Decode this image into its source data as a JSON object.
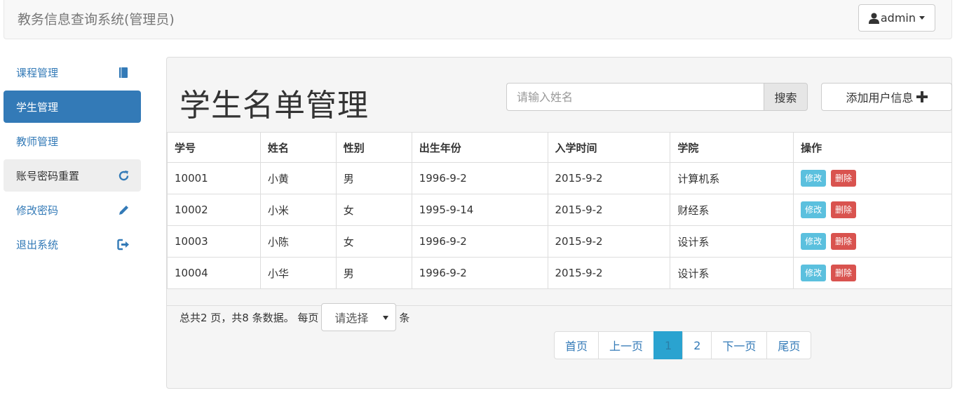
{
  "navbar": {
    "brand": "教务信息查询系统(管理员)",
    "user_label": "admin"
  },
  "sidebar": {
    "items": [
      {
        "label": "课程管理",
        "icon": "book-icon",
        "state": "normal"
      },
      {
        "label": "学生管理",
        "icon": "",
        "state": "active"
      },
      {
        "label": "教师管理",
        "icon": "",
        "state": "normal"
      },
      {
        "label": "账号密码重置",
        "icon": "refresh-icon",
        "state": "hover"
      },
      {
        "label": "修改密码",
        "icon": "pencil-icon",
        "state": "normal"
      },
      {
        "label": "退出系统",
        "icon": "logout-icon",
        "state": "normal"
      }
    ]
  },
  "main": {
    "title": "学生名单管理",
    "search": {
      "placeholder": "请输入姓名",
      "button_label": "搜索"
    },
    "add_button_label": "添加用户信息",
    "table": {
      "headers": [
        "学号",
        "姓名",
        "性别",
        "出生年份",
        "入学时间",
        "学院",
        "操作"
      ],
      "rows": [
        [
          "10001",
          "小黄",
          "男",
          "1996-9-2",
          "2015-9-2",
          "计算机系"
        ],
        [
          "10002",
          "小米",
          "女",
          "1995-9-14",
          "2015-9-2",
          "财经系"
        ],
        [
          "10003",
          "小陈",
          "女",
          "1996-9-2",
          "2015-9-2",
          "设计系"
        ],
        [
          "10004",
          "小华",
          "男",
          "1996-9-2",
          "2015-9-2",
          "设计系"
        ]
      ],
      "edit_label": "修改",
      "delete_label": "删除"
    },
    "pager": {
      "summary": "总共2 页，共8 条数据。 每页",
      "select_value": "请选择",
      "suffix": "条",
      "links": [
        "首页",
        "上一页",
        "1",
        "2",
        "下一页",
        "尾页"
      ],
      "current": "1"
    }
  },
  "colors": {
    "primary": "#337ab7",
    "info": "#5bc0de",
    "danger": "#d9534f",
    "active_page": "#2aa3d0"
  }
}
